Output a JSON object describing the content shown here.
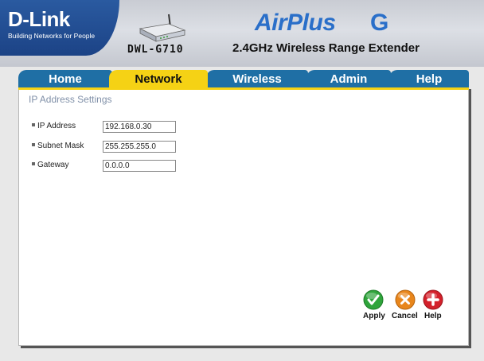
{
  "header": {
    "brand": "D-Link",
    "brand_tagline": "Building Networks for People",
    "model": "DWL-G710",
    "product_name": "AirPlus",
    "product_letter": "G",
    "product_subtitle": "2.4GHz Wireless Range Extender"
  },
  "nav": {
    "tabs": [
      {
        "label": "Home",
        "active": false
      },
      {
        "label": "Network",
        "active": true
      },
      {
        "label": "Wireless",
        "active": false
      },
      {
        "label": "Admin",
        "active": false
      },
      {
        "label": "Help",
        "active": false
      }
    ]
  },
  "main": {
    "section_title": "IP Address Settings",
    "fields": [
      {
        "label": "IP Address",
        "value": "192.168.0.30"
      },
      {
        "label": "Subnet Mask",
        "value": "255.255.255.0"
      },
      {
        "label": "Gateway",
        "value": "0.0.0.0"
      }
    ]
  },
  "actions": {
    "apply_label": "Apply",
    "cancel_label": "Cancel",
    "help_label": "Help"
  },
  "colors": {
    "brand_blue": "#1c4386",
    "tab_blue": "#1f6fa5",
    "tab_active": "#f5d215",
    "apply_green": "#2fa43b",
    "cancel_orange": "#e8861c",
    "help_red": "#d3202a"
  },
  "icons": {
    "apply": "check-icon",
    "cancel": "x-icon",
    "help": "plus-icon"
  }
}
